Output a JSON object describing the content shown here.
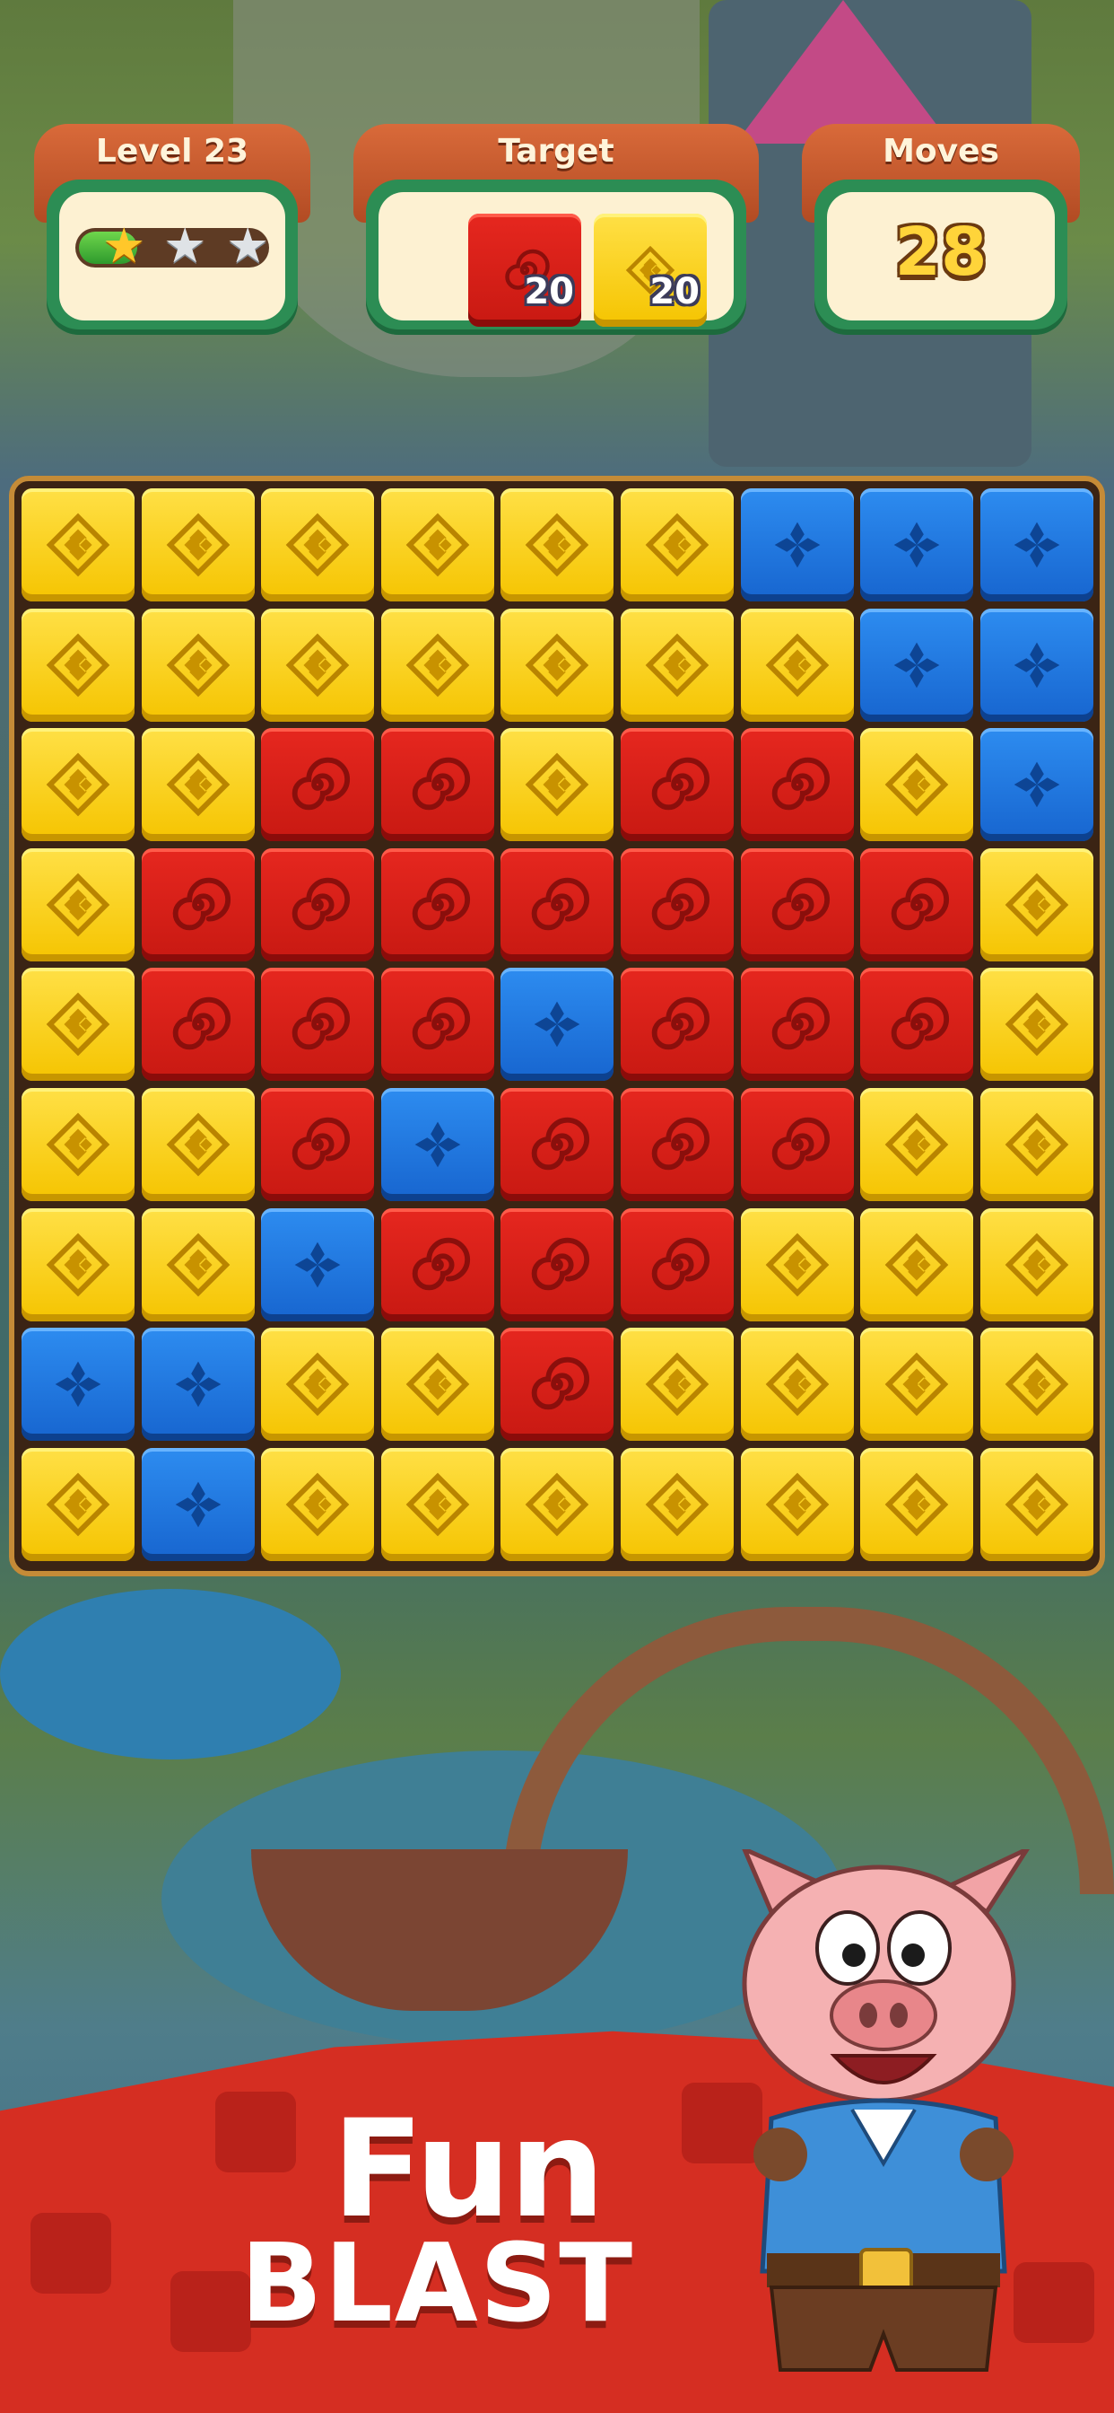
{
  "hud": {
    "level": {
      "label": "Level 23",
      "stars_earned": 1,
      "stars_total": 3,
      "progress": 0.3
    },
    "target": {
      "label": "Target",
      "items": [
        {
          "color": "red",
          "icon": "spiral-icon",
          "count": "20"
        },
        {
          "color": "yellow",
          "icon": "diamond-icon",
          "count": "20"
        }
      ]
    },
    "moves": {
      "label": "Moves",
      "value": "28"
    }
  },
  "colors": {
    "red": "#d8211a",
    "yellow": "#f9d21a",
    "blue": "#2174dd",
    "panel_tab": "#c9572b",
    "panel_border": "#2c8d54"
  },
  "board": {
    "cols": 9,
    "rows": 9,
    "grid": [
      [
        "Y",
        "Y",
        "Y",
        "Y",
        "Y",
        "Y",
        "B",
        "B",
        "B"
      ],
      [
        "Y",
        "Y",
        "Y",
        "Y",
        "Y",
        "Y",
        "Y",
        "B",
        "B"
      ],
      [
        "Y",
        "Y",
        "R",
        "R",
        "Y",
        "R",
        "R",
        "Y",
        "B"
      ],
      [
        "Y",
        "R",
        "R",
        "R",
        "R",
        "R",
        "R",
        "R",
        "Y"
      ],
      [
        "Y",
        "R",
        "R",
        "R",
        "B",
        "R",
        "R",
        "R",
        "Y"
      ],
      [
        "Y",
        "Y",
        "R",
        "B",
        "R",
        "R",
        "R",
        "Y",
        "Y"
      ],
      [
        "Y",
        "Y",
        "B",
        "R",
        "R",
        "R",
        "Y",
        "Y",
        "Y"
      ],
      [
        "B",
        "B",
        "Y",
        "Y",
        "R",
        "Y",
        "Y",
        "Y",
        "Y"
      ],
      [
        "Y",
        "B",
        "Y",
        "Y",
        "Y",
        "Y",
        "Y",
        "Y",
        "Y"
      ]
    ]
  },
  "banner": {
    "line1": "Fun",
    "line2": "BLAST",
    "mascot": "pig-mascot"
  }
}
